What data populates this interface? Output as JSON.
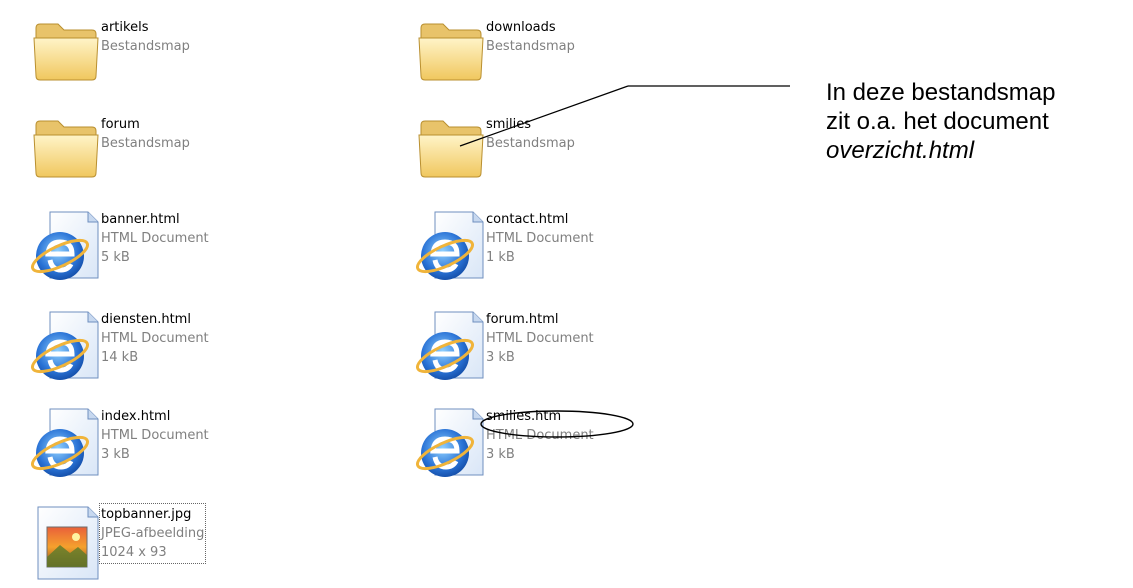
{
  "files": [
    {
      "name": "artikels",
      "type": "Bestandsmap",
      "icon": "folder-icon"
    },
    {
      "name": "downloads",
      "type": "Bestandsmap",
      "icon": "folder-icon"
    },
    {
      "name": "forum",
      "type": "Bestandsmap",
      "icon": "folder-icon"
    },
    {
      "name": "smilies",
      "type": "Bestandsmap",
      "icon": "folder-icon"
    },
    {
      "name": "banner.html",
      "type": "HTML Document",
      "size": "5 kB",
      "icon": "internet-explorer-icon"
    },
    {
      "name": "contact.html",
      "type": "HTML Document",
      "size": "1 kB",
      "icon": "internet-explorer-icon"
    },
    {
      "name": "diensten.html",
      "type": "HTML Document",
      "size": "14 kB",
      "icon": "internet-explorer-icon"
    },
    {
      "name": "forum.html",
      "type": "HTML Document",
      "size": "3 kB",
      "icon": "internet-explorer-icon"
    },
    {
      "name": "index.html",
      "type": "HTML Document",
      "size": "3 kB",
      "icon": "internet-explorer-icon"
    },
    {
      "name": "smilies.htm",
      "type": "HTML Document",
      "size": "3 kB",
      "icon": "internet-explorer-icon"
    },
    {
      "name": "topbanner.jpg",
      "type": "JPEG-afbeelding",
      "size": "1024 x 93",
      "icon": "jpeg-image-icon"
    }
  ],
  "annotation": {
    "line1": "In deze bestandsmap",
    "line2": "zit o.a. het document",
    "line3": "overzicht.html"
  },
  "colors": {
    "folder_light": "#fbe6a2",
    "folder_dark": "#e3b84f",
    "ie_blue": "#2a73d6",
    "secondary_text": "#808080"
  }
}
